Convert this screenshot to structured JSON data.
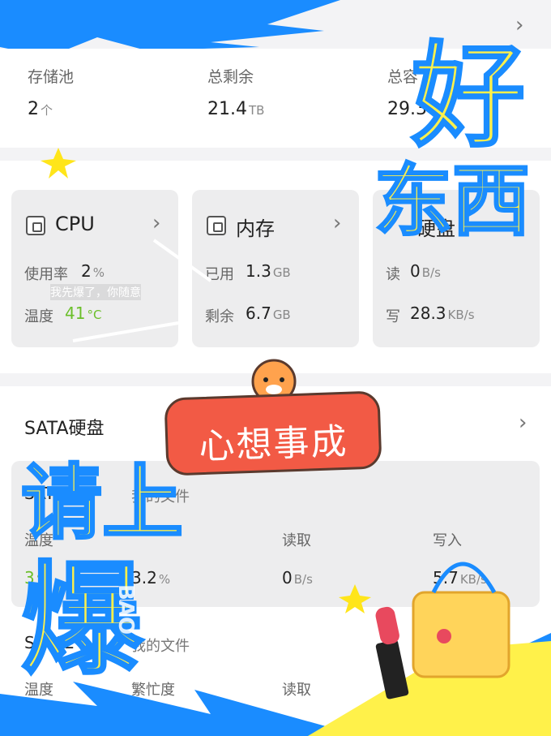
{
  "storage": {
    "pools_label": "存储池",
    "pools_value": "2",
    "pools_unit": "个",
    "remaining_label": "总剩余",
    "remaining_value": "21.4",
    "remaining_unit": "TB",
    "total_label": "总容",
    "total_value": "29.3"
  },
  "tiles": {
    "cpu": {
      "title": "CPU",
      "usage_label": "使用率",
      "usage_value": "2",
      "usage_unit": "%",
      "temp_label": "温度",
      "temp_value": "41",
      "temp_unit": "°C"
    },
    "memory": {
      "title": "内存",
      "used_label": "已用",
      "used_value": "1.3",
      "used_unit": "GB",
      "free_label": "剩余",
      "free_value": "6.7",
      "free_unit": "GB"
    },
    "disk": {
      "title": "硬盘",
      "read_label": "读",
      "read_value": "0",
      "read_unit": "B/s",
      "write_label": "写",
      "write_value": "28.3",
      "write_unit": "KB/s"
    }
  },
  "sata": {
    "title": "SATA硬盘",
    "disk1": {
      "name": "SATA1",
      "share": "我的文件",
      "temp_label": "温度",
      "temp_value": "3",
      "temp_unit": "°C",
      "busy_value": "3.2",
      "busy_unit": "%",
      "read_label": "读取",
      "read_value": "0",
      "read_unit": "B/s",
      "write_label": "写入",
      "write_value": "5.7",
      "write_unit": "KB/s"
    },
    "disk2": {
      "name": "SATA2",
      "share": "我的文件",
      "temp_label": "温度",
      "busy_label": "繁忙度",
      "read_label": "读取"
    }
  },
  "overlay": {
    "big_top": "好",
    "big_mid": "东西",
    "big_left1": "请上",
    "big_left2": "爆",
    "banner": "心想事成",
    "subtitle": "我先爆了，你随意",
    "watermark": "BAO"
  },
  "colors": {
    "accent_blue": "#1a8cff",
    "yellow": "#fff14a",
    "banner_red": "#f25a45",
    "green": "#6bbf2a"
  }
}
